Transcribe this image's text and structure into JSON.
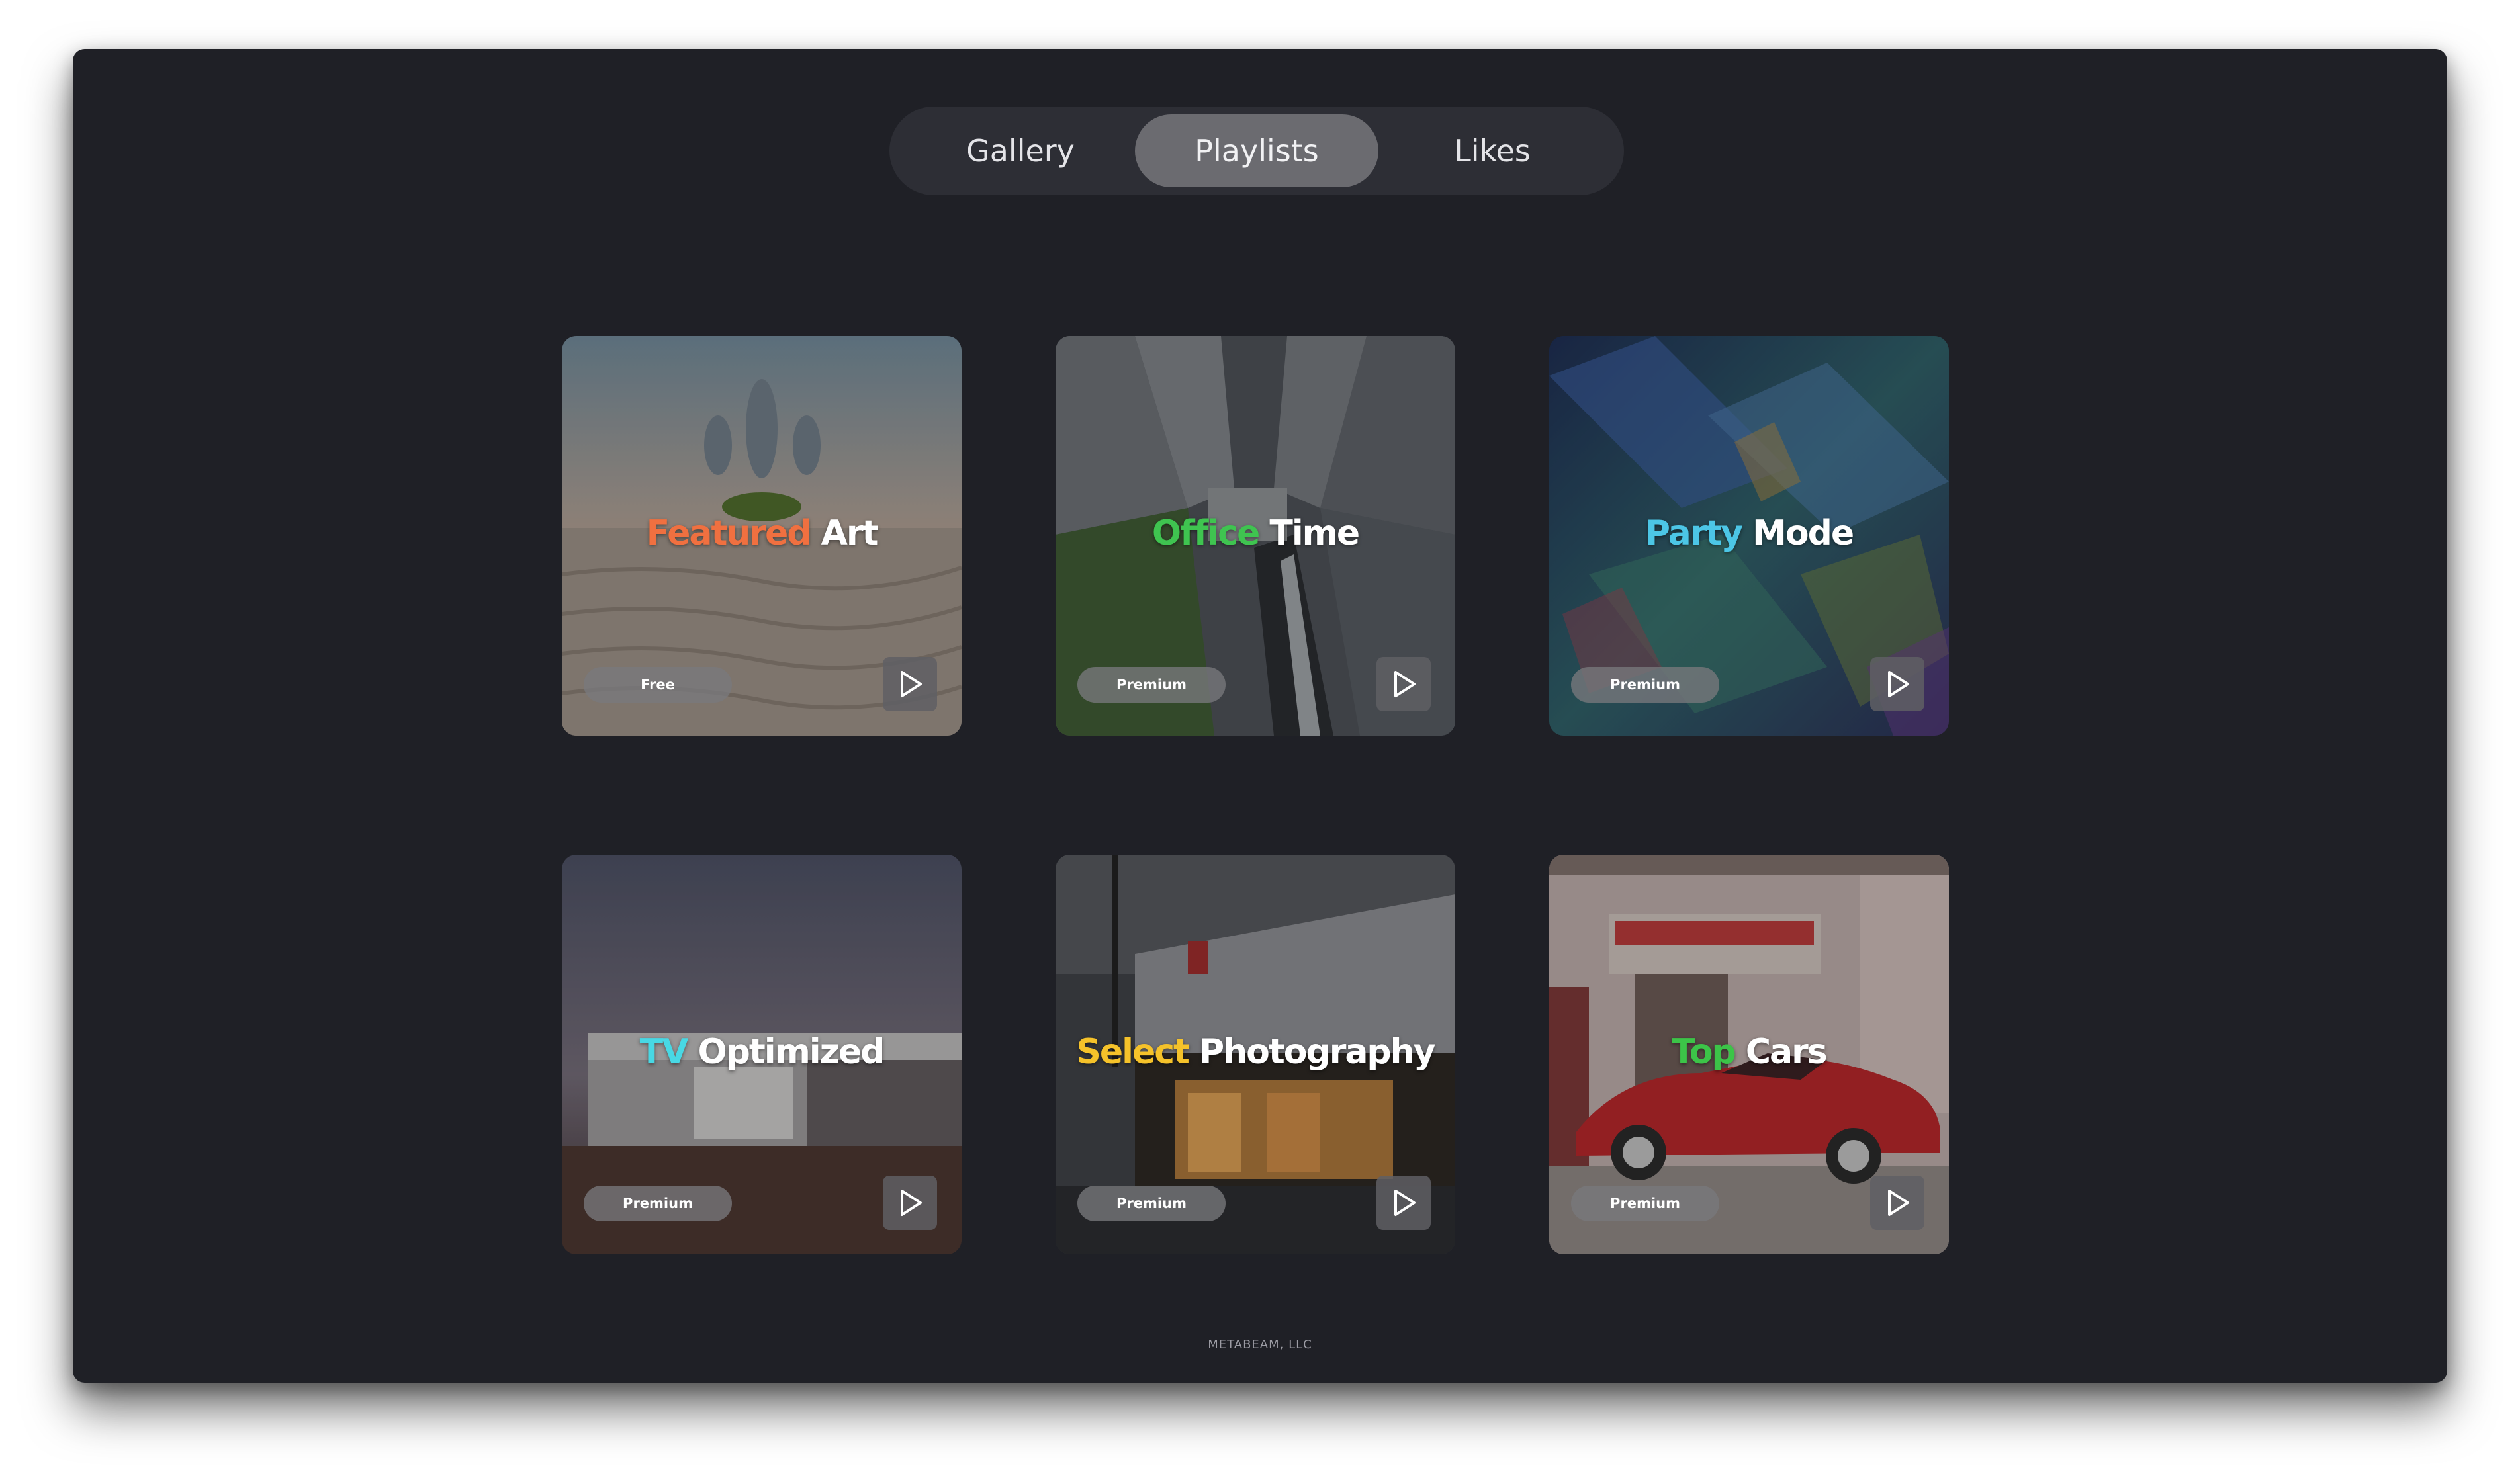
{
  "tabs": [
    {
      "label": "Gallery",
      "active": false
    },
    {
      "label": "Playlists",
      "active": true
    },
    {
      "label": "Likes",
      "active": false
    }
  ],
  "cards": [
    {
      "word1": "Featured",
      "word2": "Art",
      "accent": "#f07040",
      "badge": "Free"
    },
    {
      "word1": "Office",
      "word2": "Time",
      "accent": "#3fc450",
      "badge": "Premium"
    },
    {
      "word1": "Party",
      "word2": "Mode",
      "accent": "#4cc6e6",
      "badge": "Premium"
    },
    {
      "word1": "TV",
      "word2": "Optimized",
      "accent": "#48d8e4",
      "badge": "Premium"
    },
    {
      "word1": "Select",
      "word2": "Photography",
      "accent": "#f5c22a",
      "badge": "Premium"
    },
    {
      "word1": "Top",
      "word2": "Cars",
      "accent": "#3cc448",
      "badge": "Premium"
    }
  ],
  "icons": {
    "play": "play-icon"
  },
  "colors": {
    "background": "#1f2026",
    "tab_active": "#6b6b70",
    "tab_bar": "#2d2e35"
  },
  "footer": {
    "text": "METABEAM, LLC"
  }
}
